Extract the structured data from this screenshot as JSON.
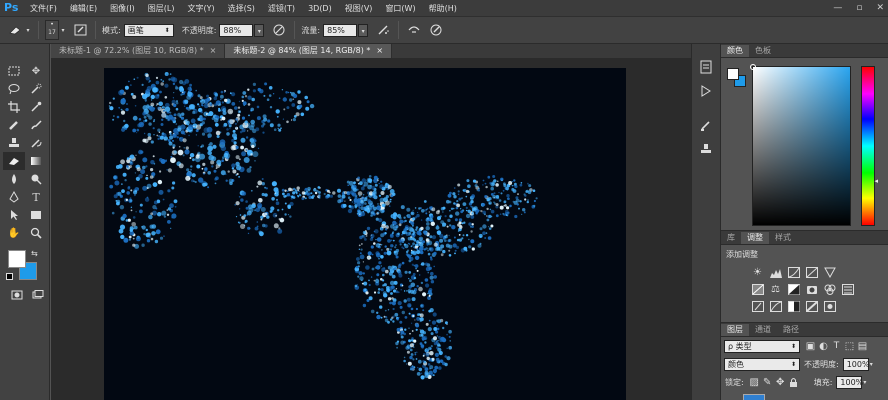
{
  "app": {
    "logo": "Ps"
  },
  "menu": [
    "文件(F)",
    "编辑(E)",
    "图像(I)",
    "图层(L)",
    "文字(Y)",
    "选择(S)",
    "滤镜(T)",
    "3D(D)",
    "视图(V)",
    "窗口(W)",
    "帮助(H)"
  ],
  "window_controls": {
    "minimize": "—",
    "restore": "▫",
    "close": "✕"
  },
  "options": {
    "brush_size": "17",
    "mode_label": "模式:",
    "mode_value": "画笔",
    "opacity_label": "不透明度:",
    "opacity_value": "88%",
    "flow_label": "流量:",
    "flow_value": "85%"
  },
  "tabs": [
    {
      "label": "未标题-1 @ 72.2% (图层 10, RGB/8) *",
      "close": "×"
    },
    {
      "label": "未标题-2 @ 84% (图层 14, RGB/8) *",
      "close": "×"
    }
  ],
  "colors": {
    "foreground": "#ffffff",
    "background": "#1e9bea",
    "canvas": "#020812",
    "accent": "#31a8ff"
  },
  "color_panel": {
    "tabs": [
      "颜色",
      "色板"
    ]
  },
  "adjustments_panel": {
    "tabs": [
      "库",
      "调整",
      "样式"
    ],
    "title": "添加调整"
  },
  "layers_panel": {
    "tabs": [
      "图层",
      "通道",
      "路径"
    ],
    "filter_label": "ρ 类型",
    "blend_mode": "颜色",
    "opacity_label": "不透明度:",
    "opacity_value": "100%",
    "lock_label": "锁定:",
    "fill_label": "填充:",
    "fill_value": "100%"
  }
}
